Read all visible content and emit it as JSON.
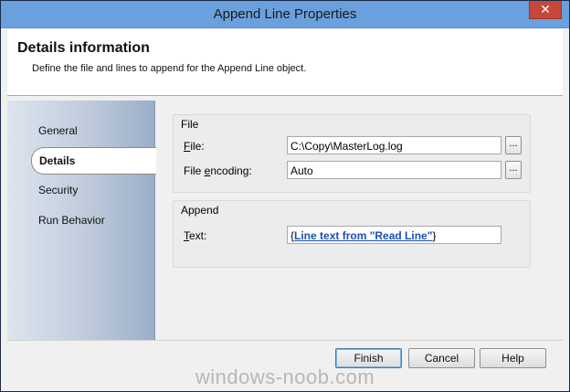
{
  "window": {
    "title": "Append Line Properties",
    "close_label": "✕"
  },
  "header": {
    "title": "Details information",
    "subtitle": "Define the file and lines to append for the Append Line object."
  },
  "nav": {
    "items": [
      {
        "label": "General",
        "selected": false
      },
      {
        "label": "Details",
        "selected": true
      },
      {
        "label": "Security",
        "selected": false
      },
      {
        "label": "Run Behavior",
        "selected": false
      }
    ]
  },
  "file_group": {
    "title": "File",
    "file_label_pre": "",
    "file_label_hot": "F",
    "file_label_post": "ile:",
    "file_value": "C:\\Copy\\MasterLog.log",
    "encoding_label_pre": "File ",
    "encoding_label_hot": "e",
    "encoding_label_post": "ncoding:",
    "encoding_value": "Auto",
    "browse_label": "..."
  },
  "append_group": {
    "title": "Append",
    "text_label_pre": "",
    "text_label_hot": "T",
    "text_label_post": "ext:",
    "brace_open": "{",
    "token": "Line text from \"Read Line\"",
    "brace_close": "}"
  },
  "buttons": {
    "finish": "Finish",
    "cancel": "Cancel",
    "help": "Help"
  },
  "watermark": "windows-noob.com"
}
